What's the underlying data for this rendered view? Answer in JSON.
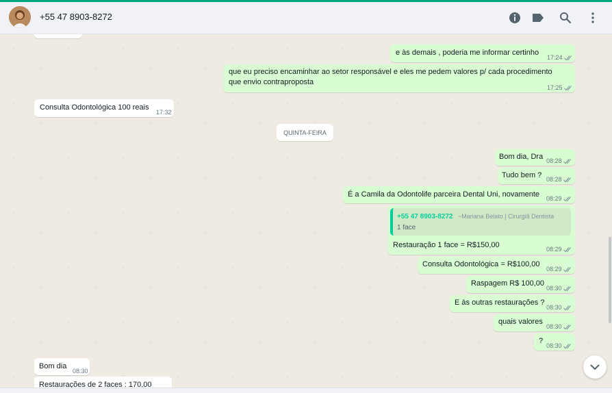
{
  "colors": {
    "accent": "#00a884",
    "outgoing_bubble": "#d9fdd3",
    "incoming_bubble": "#ffffff",
    "chat_background": "#efeae2",
    "header_background": "#f0f2f5",
    "quote_accent": "#06cf9c"
  },
  "header": {
    "contact_name": "+55 47 8903-8272",
    "icons": [
      "info-icon",
      "label-icon",
      "search-icon",
      "menu-icon"
    ]
  },
  "messages": {
    "m1": {
      "text": "e às demais , poderia me informar certinho",
      "time": "17:24"
    },
    "m2": {
      "line1": "que eu preciso encaminhar ao setor responsável e eles me pedem valores p/ cada procedimento",
      "line2": "que envio contraproposta",
      "time": "17:25"
    },
    "m3": {
      "text": "Consulta Odontológica 100 reais",
      "time": "17:32"
    },
    "day": "QUINTA-FEIRA",
    "m4": {
      "text": "Bom dia, Dra",
      "time": "08:28"
    },
    "m5": {
      "text": "Tudo bem ?",
      "time": "08:28"
    },
    "m6": {
      "text": "É a Camila da Odontolife parceira Dental Uni, novamente",
      "time": "08:29"
    },
    "m7": {
      "quote_name": "+55 47 8903-8272",
      "quote_author": "~Mariana Belato | Cirurgiã Dentista",
      "quote_text": "1 face",
      "text": "Restauração 1 face = R$150,00",
      "time": "08:29"
    },
    "m8": {
      "text": "Consulta Odontológica = R$100,00",
      "time": "08:29"
    },
    "m9": {
      "text": "Raspagem R$ 100,00",
      "time": "08:30"
    },
    "m10": {
      "text": "E às outras restaurações ?",
      "time": "08:30"
    },
    "m11": {
      "text": "quais valores",
      "time": "08:30"
    },
    "m12": {
      "text": "?",
      "time": "08:30"
    },
    "m13": {
      "text": "Bom dia",
      "time": "08:30"
    },
    "m14": {
      "text": "Restaurações de 2 faces : 170,00"
    }
  }
}
